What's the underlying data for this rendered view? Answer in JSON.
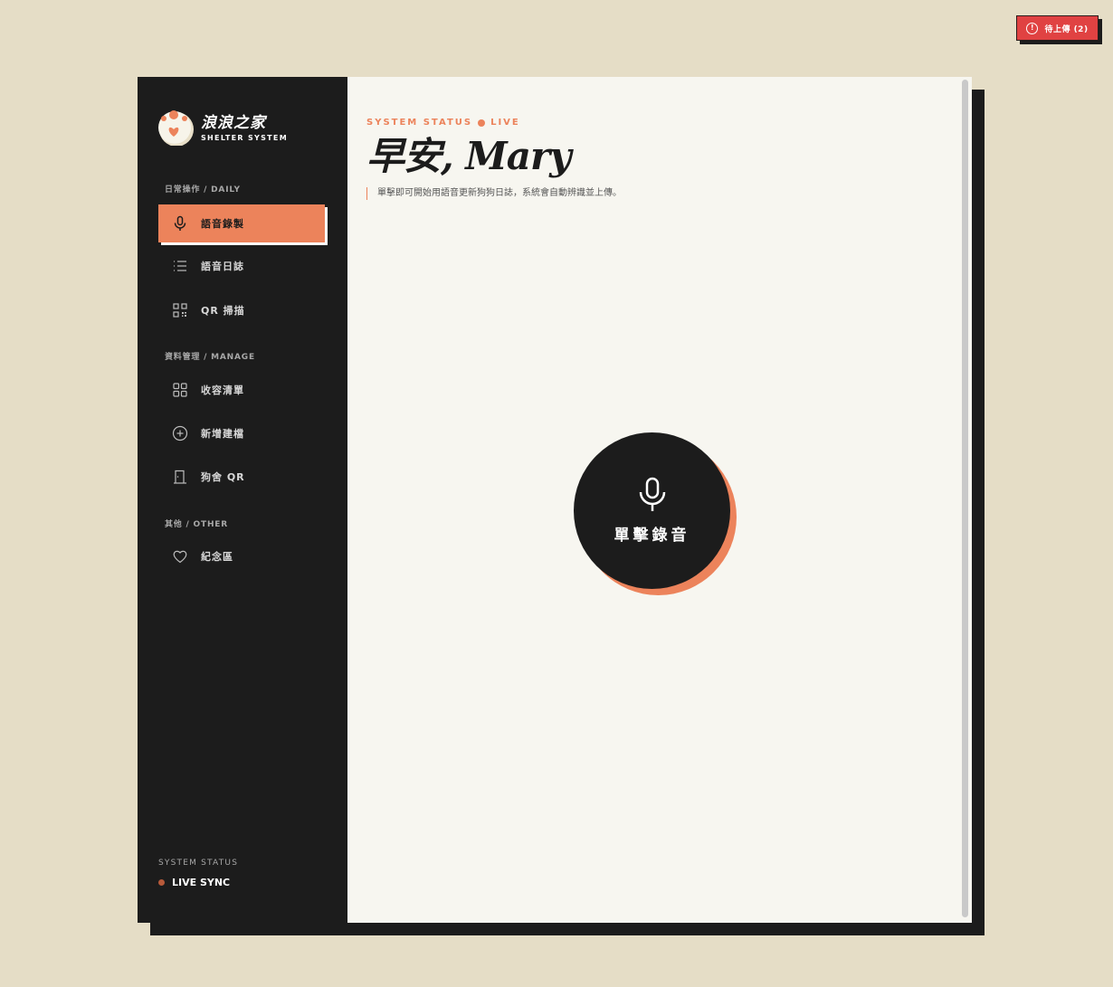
{
  "pending_upload": {
    "label": "待上傳 (2)",
    "icon": "warning-circle-icon"
  },
  "sidebar": {
    "logo": {
      "title": "浪浪之家",
      "subtitle": "SHELTER SYSTEM"
    },
    "sections": [
      {
        "label": "日常操作 / DAILY",
        "items": [
          {
            "label": "語音錄製",
            "icon": "microphone-icon",
            "active": true
          },
          {
            "label": "語音日誌",
            "icon": "list-icon"
          },
          {
            "label": "QR 掃描",
            "icon": "qr-code-icon"
          }
        ]
      },
      {
        "label": "資料管理 / MANAGE",
        "items": [
          {
            "label": "收容清單",
            "icon": "grid-icon"
          },
          {
            "label": "新增建檔",
            "icon": "add-circle-icon"
          },
          {
            "label": "狗舍 QR",
            "icon": "door-icon"
          }
        ]
      },
      {
        "label": "其他 / OTHER",
        "items": [
          {
            "label": "紀念區",
            "icon": "heart-icon"
          }
        ]
      }
    ],
    "status": {
      "label": "SYSTEM STATUS",
      "value": "LIVE SYNC"
    }
  },
  "main": {
    "eyebrow_left": "SYSTEM STATUS",
    "eyebrow_right": "LIVE",
    "greeting": "早安, Mary",
    "subtitle": "單擊即可開始用語音更新狗狗日誌，系統會自動辨識並上傳。",
    "record_button": {
      "label": "單擊錄音",
      "icon": "microphone-icon"
    }
  },
  "colors": {
    "accent": "#ec835b",
    "dark": "#1c1c1c",
    "page": "#e5ddc6",
    "panel": "#f7f6f0",
    "alert": "#e04242"
  }
}
